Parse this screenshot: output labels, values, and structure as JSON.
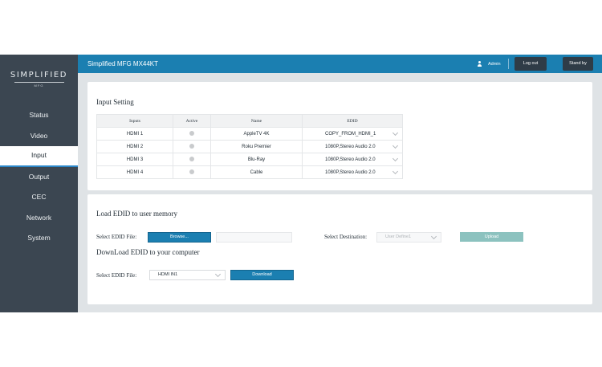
{
  "logo": {
    "main": "SIMPLIFIED",
    "sub": "MFG"
  },
  "app": {
    "title": "Simplified MFG MX44KT"
  },
  "user": {
    "name": "Admin"
  },
  "header": {
    "logout_label": "Log out",
    "standby_label": "Stand by"
  },
  "sidebar": {
    "items": [
      {
        "label": "Status"
      },
      {
        "label": "Video"
      },
      {
        "label": "Input",
        "active": true
      },
      {
        "label": "Output"
      },
      {
        "label": "CEC"
      },
      {
        "label": "Network"
      },
      {
        "label": "System"
      }
    ]
  },
  "input_setting": {
    "title": "Input Setting",
    "columns": [
      "Inputs",
      "Active",
      "Name",
      "EDID"
    ],
    "rows": [
      {
        "input": "HDMI 1",
        "name": "AppleTV 4K",
        "edid": "COPY_FROM_HDMI_1"
      },
      {
        "input": "HDMI 2",
        "name": "Roku Premier",
        "edid": "1080P,Stereo Audio 2.0"
      },
      {
        "input": "HDMI 3",
        "name": "Blu-Ray",
        "edid": "1080P,Stereo Audio 2.0"
      },
      {
        "input": "HDMI 4",
        "name": "Cable",
        "edid": "1080P,Stereo Audio 2.0"
      }
    ]
  },
  "load_edid": {
    "title": "Load EDID to user memory",
    "file_label": "Select EDID File:",
    "browse_label": "Browse...",
    "file_value": "",
    "destination_label": "Select Destination:",
    "destination_placeholder": "User Define1",
    "upload_label": "Upload"
  },
  "download_edid": {
    "title": "DownLoad EDID to your computer",
    "file_label": "Select EDID File:",
    "file_value": "HDMI IN1",
    "download_label": "Download"
  },
  "colors": {
    "topbar": "#1b7fb1",
    "sidebar": "#3b4651",
    "active_underline": "#2b87c9",
    "upload_disabled": "#8cc2bf"
  }
}
